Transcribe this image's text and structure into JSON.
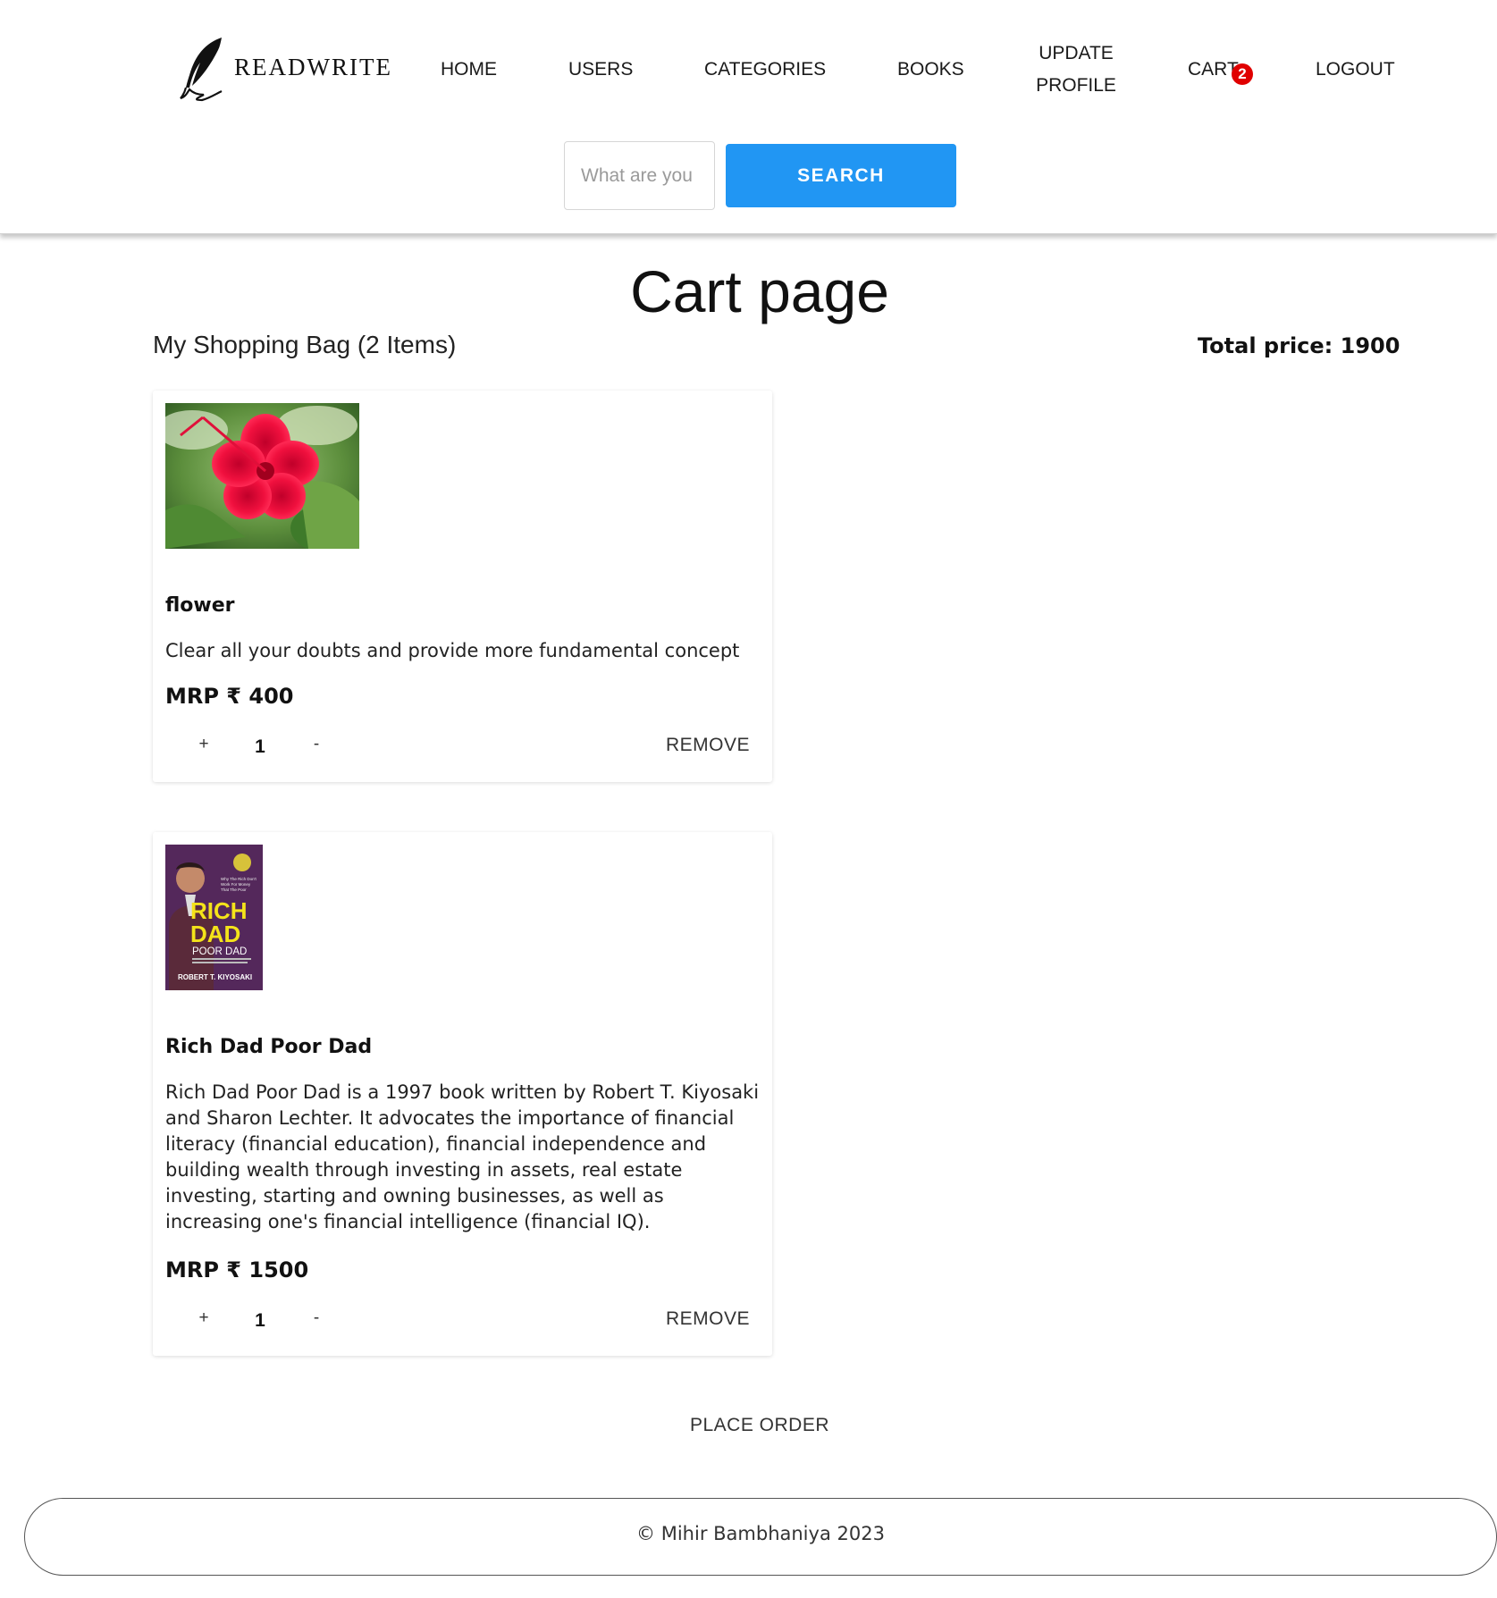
{
  "header": {
    "logo_text": "READWRITE",
    "nav": {
      "home": "HOME",
      "users": "USERS",
      "categories": "CATEGORIES",
      "books": "BOOKS",
      "update_line1": "UPDATE",
      "update_line2": "PROFILE",
      "cart": "CART",
      "cart_count": "2",
      "logout": "LOGOUT"
    },
    "search": {
      "placeholder": "What are you looking for?",
      "button_label": "SEARCH"
    }
  },
  "main": {
    "page_title": "Cart page",
    "bag_title": "My Shopping Bag (2 Items)",
    "total_price": "Total price: 1900",
    "items": [
      {
        "name": "flower",
        "description": "Clear all your doubts and provide more fundamental concept",
        "price": "MRP ₹ 400",
        "qty_plus": "+",
        "quantity": "1",
        "qty_minus": "-",
        "remove_label": "REMOVE"
      },
      {
        "name": "Rich Dad Poor Dad",
        "description": "Rich Dad Poor Dad is a 1997 book written by Robert T. Kiyosaki and Sharon Lechter. It advocates the importance of financial literacy (financial education), financial independence and building wealth through investing in assets, real estate investing, starting and owning businesses, as well as increasing one's financial intelligence (financial IQ).",
        "price": "MRP ₹ 1500",
        "qty_plus": "+",
        "quantity": "1",
        "qty_minus": "-",
        "remove_label": "REMOVE",
        "cover_text": {
          "rich": "RICH",
          "dad": "DAD",
          "poor_dad": "POOR DAD",
          "author": "ROBERT T. KIYOSAKI"
        }
      }
    ],
    "place_order": "PLACE ORDER"
  },
  "footer": {
    "text": "© Mihir Bambhaniya 2023"
  },
  "colors": {
    "search_button": "#2196f3",
    "cart_badge": "#e00000"
  }
}
